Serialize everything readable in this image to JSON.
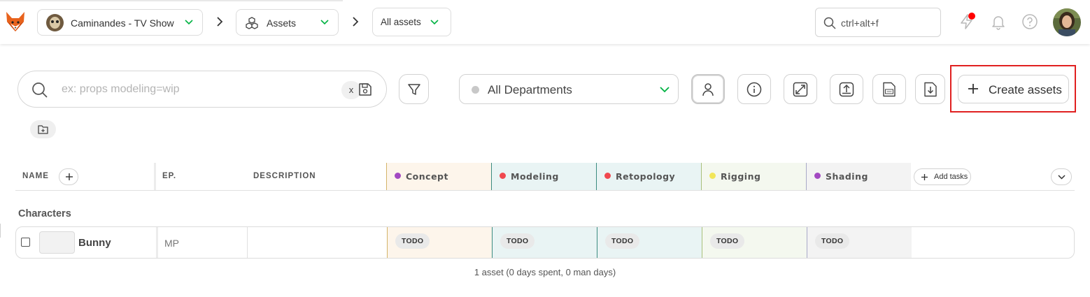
{
  "topbar": {
    "production": "Caminandes - TV Show",
    "section": "Assets",
    "episode": "All assets",
    "search_placeholder": "ctrl+alt+f"
  },
  "toolbar": {
    "search_placeholder": "ex: props modeling=wip",
    "clear_label": "x",
    "department": "All Departments",
    "create_label": "Create assets"
  },
  "table": {
    "headers": {
      "name": "NAME",
      "episode": "EP.",
      "description": "DESCRIPTION"
    },
    "add_tasks_label": "Add tasks",
    "task_types": [
      {
        "name": "Concept",
        "color": "#a349c2",
        "bg": "#fdf5eb",
        "border": "#d4b46a"
      },
      {
        "name": "Modeling",
        "color": "#f0484f",
        "bg": "#e9f4f4",
        "border": "#3b8b80"
      },
      {
        "name": "Retopology",
        "color": "#f0484f",
        "bg": "#e9f4f4",
        "border": "#3b8b80"
      },
      {
        "name": "Rigging",
        "color": "#f2e65a",
        "bg": "#f4f8ef",
        "border": "#a9c07c"
      },
      {
        "name": "Shading",
        "color": "#a349c2",
        "bg": "#f3f3f3",
        "border": "#a9a9c8"
      }
    ],
    "group": "Characters",
    "rows": [
      {
        "name": "Bunny",
        "episode": "MP",
        "description": "",
        "statuses": [
          "TODO",
          "TODO",
          "TODO",
          "TODO",
          "TODO"
        ]
      }
    ],
    "summary": "1 asset (0 days spent, 0 man days)"
  },
  "colors": {
    "accent_green": "#00b242",
    "notification": "#ff0000",
    "highlight": "#e02020"
  }
}
